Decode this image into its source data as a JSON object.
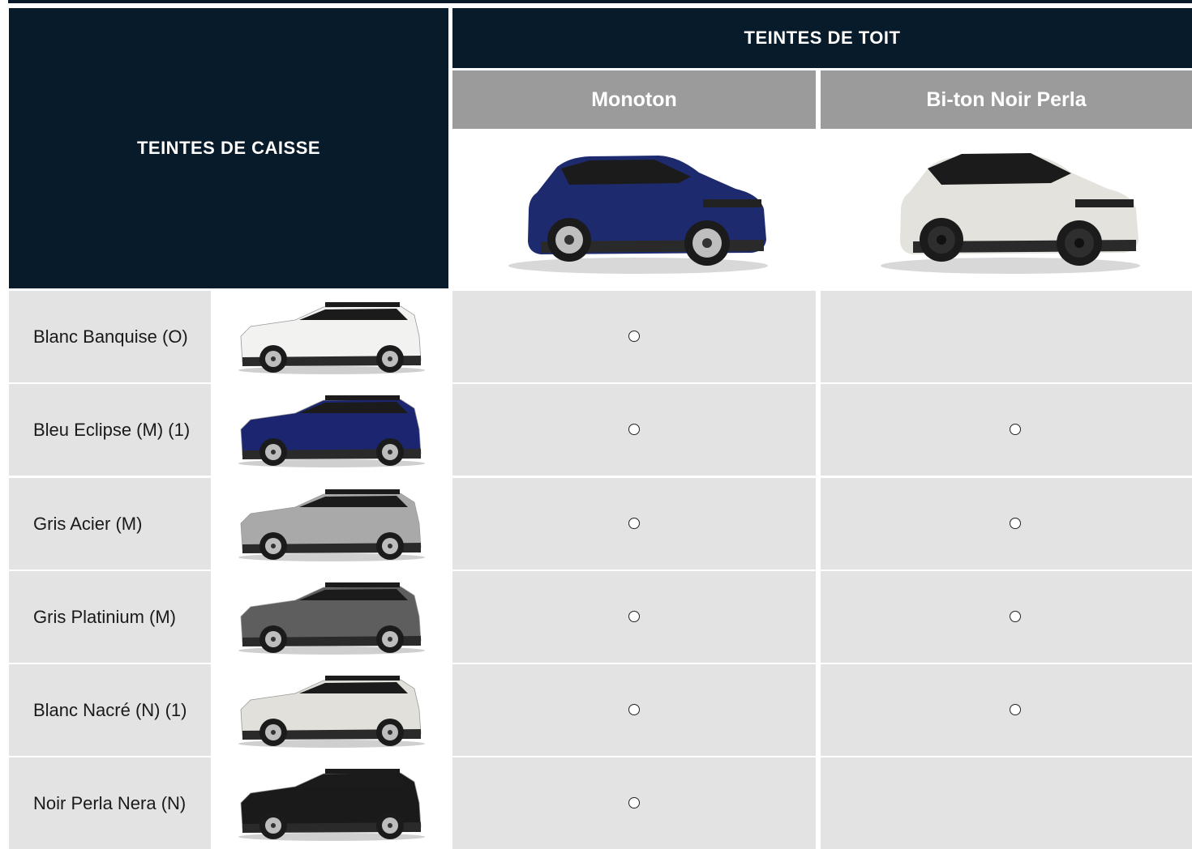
{
  "header": {
    "body_colours_title": "TEINTES DE CAISSE",
    "roof_colours_title": "TEINTES DE TOIT",
    "roof_options": [
      "Monoton",
      "Bi-ton Noir Perla"
    ]
  },
  "hero_colors": {
    "monoton": "#1e2a6e",
    "biton": "#e4e2dc"
  },
  "rows": [
    {
      "label": "Blanc Banquise (O)",
      "body_color": "#f2f2f0",
      "monoton": true,
      "biton": false
    },
    {
      "label": "Bleu Eclipse (M) (1)",
      "body_color": "#1c2670",
      "monoton": true,
      "biton": true
    },
    {
      "label": "Gris Acier (M)",
      "body_color": "#a9a9a9",
      "monoton": true,
      "biton": true
    },
    {
      "label": "Gris Platinium (M)",
      "body_color": "#5e5e5e",
      "monoton": true,
      "biton": true
    },
    {
      "label": "Blanc Nacré (N) (1)",
      "body_color": "#e2e0da",
      "monoton": true,
      "biton": true
    },
    {
      "label": "Noir Perla Nera (N)",
      "body_color": "#1a1a1a",
      "monoton": true,
      "biton": false
    }
  ]
}
